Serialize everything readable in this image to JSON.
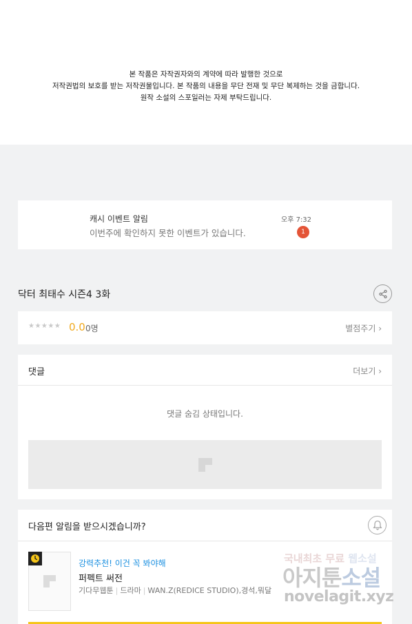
{
  "notice": {
    "line1": "본 작품은 자작권자와의 계약에 따라 발행한 것으로",
    "line2": "저작권법의 보호를 받는 저작권물입니다. 본 작품의 내용을 무단 전재 및 무단 복제하는 것을 금합니다.",
    "line3": "원작 소설의 스포일러는 자제 부탁드립니다."
  },
  "push": {
    "title": "캐시 이벤트 알림",
    "body": "이번주에 확인하지 못한 이벤트가 있습니다.",
    "time": "오후 7:32",
    "badge": "1"
  },
  "episode": {
    "title": "닥터 최태수 시즌4 3화",
    "share_icon": "share-icon"
  },
  "rating": {
    "stars": "★★★★★",
    "score": "0.0",
    "count": "0명",
    "rate_label": "별점주기 ›"
  },
  "comments": {
    "title": "댓글",
    "more": "더보기 ›",
    "hidden_notice": "댓글 숨김 상태입니다."
  },
  "next_alert": {
    "title": "다음편 알림을 받으시겠습니까?",
    "bell_icon": "bell-icon"
  },
  "recommend": {
    "tag": "강력추천! 이건 꼭 봐야해",
    "name": "퍼펙트 써전",
    "genre1": "기다무웹툰",
    "genre2": "드라마",
    "author": "WAN.Z(REDICE STUDIO),경석,뭐달"
  },
  "watermark": {
    "top_a": "국내최초 무료 ",
    "top_b": "웹소설",
    "mid_a": "아지툰",
    "mid_b": "소설",
    "url": "novelagit.xyz"
  },
  "colors": {
    "accent_score": "#f0a81c",
    "badge": "#e45437",
    "recommend_tag": "#1a8fe0",
    "bottom_bar": "#f5c518"
  }
}
